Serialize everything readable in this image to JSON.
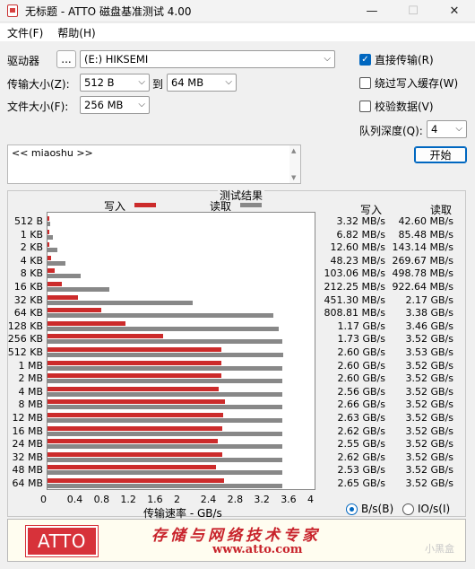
{
  "window": {
    "title": "无标题 - ATTO 磁盘基准测试 4.00",
    "minimize": "—",
    "maximize": "☐",
    "close": "✕"
  },
  "menu": {
    "file": "文件(F)",
    "help": "帮助(H)"
  },
  "drive": {
    "label": "驱动器",
    "browse": "...",
    "value": "(E:) HIKSEMI"
  },
  "transfer": {
    "label": "传输大小(Z):",
    "from": "512 B",
    "to_label": "到",
    "to": "64 MB"
  },
  "filesize": {
    "label": "文件大小(F):",
    "value": "256 MB"
  },
  "options": {
    "direct_io": {
      "label": "直接传输(R)",
      "checked": true
    },
    "bypass_cache": {
      "label": "绕过写入缓存(W)",
      "checked": false
    },
    "verify": {
      "label": "校验数据(V)",
      "checked": false
    }
  },
  "queue": {
    "label": "队列深度(Q):",
    "value": "4"
  },
  "start_button": "开始",
  "description": "<< miaoshu >>",
  "results": {
    "title": "测试结果",
    "legend_write": "写入",
    "legend_read": "读取",
    "col_write": "写入",
    "col_read": "读取",
    "xaxis_title": "传输速率 - GB/s",
    "xticks": [
      "0",
      "0.4",
      "0.8",
      "1.2",
      "1.6",
      "2",
      "2.4",
      "2.8",
      "3.2",
      "3.6",
      "4"
    ]
  },
  "units": {
    "bs": "B/s(B)",
    "ios": "IO/s(I)",
    "selected": "bs"
  },
  "banner": {
    "logo": "ATTO",
    "slogan": "存储与网络技术专家",
    "url": "www.atto.com"
  },
  "watermark": "小黑盒",
  "colors": {
    "write": "#cc2b2b",
    "read": "#888888",
    "accent": "#0067c0"
  },
  "chart_data": {
    "type": "bar",
    "orientation": "horizontal",
    "xlabel": "传输速率 - GB/s",
    "xlim": [
      0,
      4
    ],
    "categories": [
      "512 B",
      "1 KB",
      "2 KB",
      "4 KB",
      "8 KB",
      "16 KB",
      "32 KB",
      "64 KB",
      "128 KB",
      "256 KB",
      "512 KB",
      "1 MB",
      "2 MB",
      "4 MB",
      "8 MB",
      "12 MB",
      "16 MB",
      "24 MB",
      "32 MB",
      "48 MB",
      "64 MB"
    ],
    "series": [
      {
        "name": "写入",
        "values": [
          0.0033,
          0.0068,
          0.0126,
          0.0482,
          0.1031,
          0.2123,
          0.4513,
          0.8088,
          1.17,
          1.73,
          2.6,
          2.6,
          2.6,
          2.56,
          2.66,
          2.63,
          2.62,
          2.55,
          2.62,
          2.53,
          2.65
        ],
        "labels": [
          "3.32 MB/s",
          "6.82 MB/s",
          "12.60 MB/s",
          "48.23 MB/s",
          "103.06 MB/s",
          "212.25 MB/s",
          "451.30 MB/s",
          "808.81 MB/s",
          "1.17 GB/s",
          "1.73 GB/s",
          "2.60 GB/s",
          "2.60 GB/s",
          "2.60 GB/s",
          "2.56 GB/s",
          "2.66 GB/s",
          "2.63 GB/s",
          "2.62 GB/s",
          "2.55 GB/s",
          "2.62 GB/s",
          "2.53 GB/s",
          "2.65 GB/s"
        ]
      },
      {
        "name": "读取",
        "values": [
          0.0426,
          0.0855,
          0.1431,
          0.2697,
          0.4988,
          0.9226,
          2.17,
          3.38,
          3.46,
          3.52,
          3.53,
          3.52,
          3.52,
          3.52,
          3.52,
          3.52,
          3.52,
          3.52,
          3.52,
          3.52,
          3.52
        ],
        "labels": [
          "42.60 MB/s",
          "85.48 MB/s",
          "143.14 MB/s",
          "269.67 MB/s",
          "498.78 MB/s",
          "922.64 MB/s",
          "2.17 GB/s",
          "3.38 GB/s",
          "3.46 GB/s",
          "3.52 GB/s",
          "3.53 GB/s",
          "3.52 GB/s",
          "3.52 GB/s",
          "3.52 GB/s",
          "3.52 GB/s",
          "3.52 GB/s",
          "3.52 GB/s",
          "3.52 GB/s",
          "3.52 GB/s",
          "3.52 GB/s",
          "3.52 GB/s"
        ]
      }
    ]
  }
}
